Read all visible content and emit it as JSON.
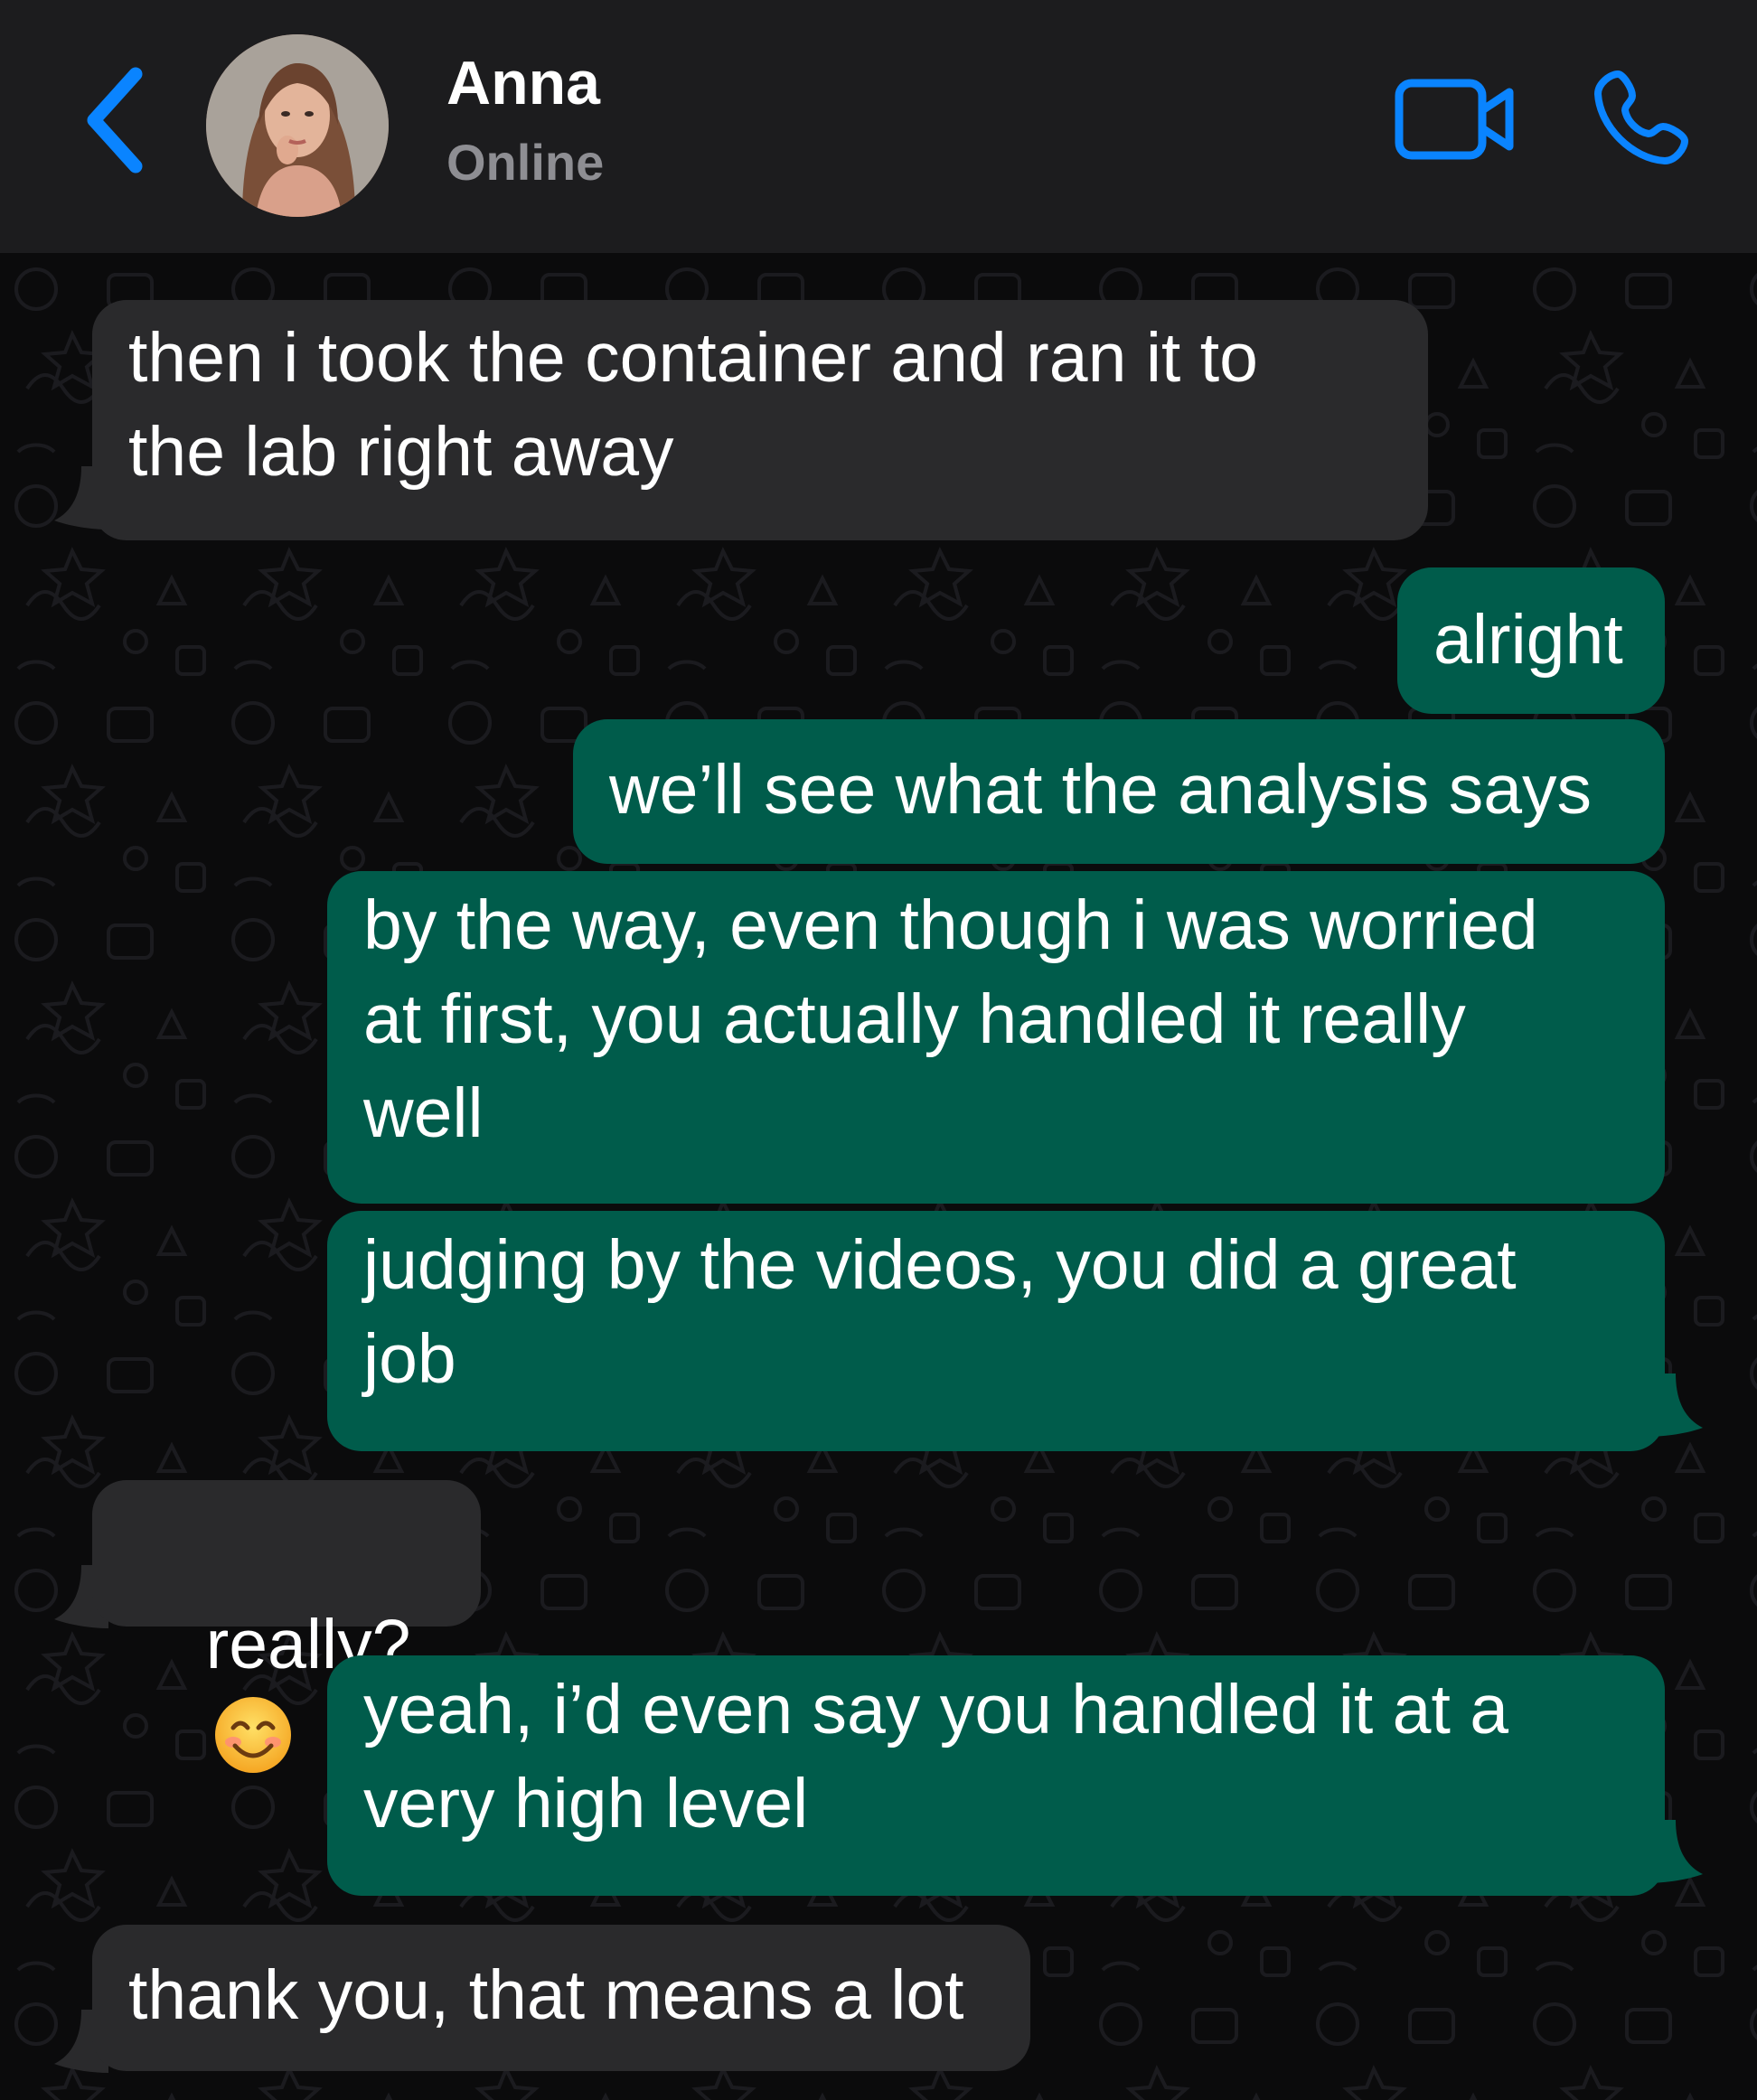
{
  "header": {
    "contact_name": "Anna",
    "status": "Online",
    "icons": {
      "back": "chevron-left-icon",
      "video": "video-camera-icon",
      "phone": "phone-icon"
    },
    "accent_color": "#0a84ff",
    "background_color": "#1c1c1e"
  },
  "chat": {
    "incoming_bubble_color": "#2a2a2c",
    "outgoing_bubble_color": "#005c4b",
    "messages": [
      {
        "direction": "incoming",
        "text": "then i took the container and ran it to\nthe lab right away"
      },
      {
        "direction": "outgoing",
        "text": "alright"
      },
      {
        "direction": "outgoing",
        "text": "we’ll see what the analysis says"
      },
      {
        "direction": "outgoing",
        "text": "by the way, even though i was worried\nat first, you actually handled it really\nwell"
      },
      {
        "direction": "outgoing",
        "text": "judging by the videos, you did a great\njob"
      },
      {
        "direction": "incoming",
        "text": "really?",
        "emoji": "smiling-face-icon"
      },
      {
        "direction": "outgoing",
        "text": "yeah, i’d even say you handled it at a\nvery high level"
      },
      {
        "direction": "incoming",
        "text": "thank you, that means a lot"
      }
    ]
  }
}
